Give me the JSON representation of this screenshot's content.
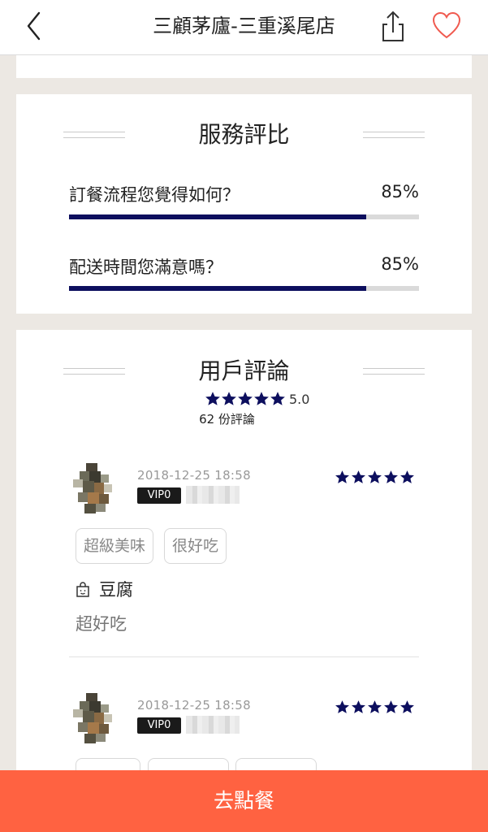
{
  "nav": {
    "title": "三顧茅廬-三重溪尾店",
    "back_icon": "chevron-left-icon",
    "share_icon": "share-icon",
    "favorite_icon": "heart-outline-icon"
  },
  "service": {
    "title": "服務評比",
    "questions": [
      {
        "label": "訂餐流程您覺得如何？",
        "percent_text": "85%",
        "percent": 85
      },
      {
        "label": "配送時間您滿意嗎？",
        "percent_text": "85%",
        "percent": 85
      }
    ]
  },
  "reviews": {
    "title": "用戶評論",
    "score": "5.0",
    "stars": 5,
    "count_text": "62 份評論",
    "items": [
      {
        "time": "2018-12-25 18:58",
        "vip": "VIP0",
        "stars": 5,
        "tags": [
          "超級美味",
          "很好吃"
        ],
        "dish": "豆腐",
        "text": "超好吃"
      },
      {
        "time": "2018-12-25 18:58",
        "vip": "VIP0",
        "stars": 5
      }
    ]
  },
  "order_button": "去點餐",
  "colors": {
    "accent": "#ff6241",
    "navy": "#0d0f5e",
    "background": "#ece8e3",
    "heart": "#f05a4f"
  }
}
